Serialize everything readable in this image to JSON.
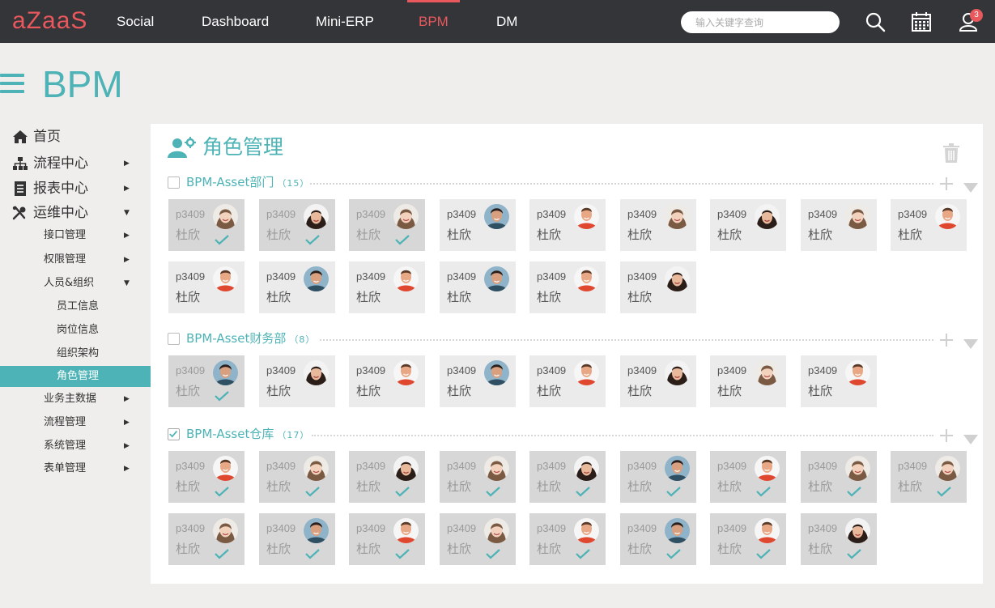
{
  "app": {
    "logo": "aZaaS",
    "nav": [
      "Social",
      "Dashboard",
      "Mini-ERP",
      "BPM",
      "DM"
    ],
    "active_nav": "BPM",
    "search_placeholder": "输入关键字查询",
    "notification_count": "3",
    "accent_color": "#4db3b6",
    "brand_color": "#e8585c"
  },
  "page": {
    "title": "BPM"
  },
  "sidebar": [
    {
      "label": "首页",
      "level": 0,
      "icon": "home-icon",
      "arrow": ""
    },
    {
      "label": "流程中心",
      "level": 0,
      "icon": "sitemap-icon",
      "arrow": "▶"
    },
    {
      "label": "报表中心",
      "level": 0,
      "icon": "report-icon",
      "arrow": "▶"
    },
    {
      "label": "运维中心",
      "level": 0,
      "icon": "tools-icon",
      "arrow": "▼"
    },
    {
      "label": "接口管理",
      "level": 1,
      "arrow": "▶"
    },
    {
      "label": "权限管理",
      "level": 1,
      "arrow": "▶"
    },
    {
      "label": "人员&组织",
      "level": 1,
      "arrow": "▼"
    },
    {
      "label": "员工信息",
      "level": 2,
      "arrow": ""
    },
    {
      "label": "岗位信息",
      "level": 2,
      "arrow": ""
    },
    {
      "label": "组织架构",
      "level": 2,
      "arrow": ""
    },
    {
      "label": "角色管理",
      "level": 2,
      "arrow": "",
      "active": true
    },
    {
      "label": "业务主数据",
      "level": 1,
      "arrow": "▶"
    },
    {
      "label": "流程管理",
      "level": 1,
      "arrow": "▶"
    },
    {
      "label": "系统管理",
      "level": 1,
      "arrow": "▶"
    },
    {
      "label": "表单管理",
      "level": 1,
      "arrow": "▶"
    }
  ],
  "panel": {
    "title": "角色管理",
    "groups": [
      {
        "name": "BPM-Asset部门",
        "count": "（15）",
        "checked": false,
        "members": [
          {
            "id": "p3409",
            "name": "杜欣",
            "selected": true,
            "avatar": "woman-smile"
          },
          {
            "id": "p3409",
            "name": "杜欣",
            "selected": true,
            "avatar": "woman-dark"
          },
          {
            "id": "p3409",
            "name": "杜欣",
            "selected": true,
            "avatar": "woman-smile"
          },
          {
            "id": "p3409",
            "name": "杜欣",
            "selected": false,
            "avatar": "man-outdoor"
          },
          {
            "id": "p3409",
            "name": "杜欣",
            "selected": false,
            "avatar": "man-red"
          },
          {
            "id": "p3409",
            "name": "杜欣",
            "selected": false,
            "avatar": "woman-smile"
          },
          {
            "id": "p3409",
            "name": "杜欣",
            "selected": false,
            "avatar": "woman-dark"
          },
          {
            "id": "p3409",
            "name": "杜欣",
            "selected": false,
            "avatar": "woman-smile"
          },
          {
            "id": "p3409",
            "name": "杜欣",
            "selected": false,
            "avatar": "man-red"
          },
          {
            "id": "p3409",
            "name": "杜欣",
            "selected": false,
            "avatar": "man-red"
          },
          {
            "id": "p3409",
            "name": "杜欣",
            "selected": false,
            "avatar": "man-outdoor"
          },
          {
            "id": "p3409",
            "name": "杜欣",
            "selected": false,
            "avatar": "man-red"
          },
          {
            "id": "p3409",
            "name": "杜欣",
            "selected": false,
            "avatar": "man-outdoor"
          },
          {
            "id": "p3409",
            "name": "杜欣",
            "selected": false,
            "avatar": "man-red"
          },
          {
            "id": "p3409",
            "name": "杜欣",
            "selected": false,
            "avatar": "woman-dark"
          }
        ]
      },
      {
        "name": "BPM-Asset财务部",
        "count": "（8）",
        "checked": false,
        "members": [
          {
            "id": "p3409",
            "name": "杜欣",
            "selected": true,
            "avatar": "man-outdoor"
          },
          {
            "id": "p3409",
            "name": "杜欣",
            "selected": false,
            "avatar": "woman-dark"
          },
          {
            "id": "p3409",
            "name": "杜欣",
            "selected": false,
            "avatar": "man-red"
          },
          {
            "id": "p3409",
            "name": "杜欣",
            "selected": false,
            "avatar": "man-outdoor"
          },
          {
            "id": "p3409",
            "name": "杜欣",
            "selected": false,
            "avatar": "man-red"
          },
          {
            "id": "p3409",
            "name": "杜欣",
            "selected": false,
            "avatar": "woman-dark"
          },
          {
            "id": "p3409",
            "name": "杜欣",
            "selected": false,
            "avatar": "woman-smile"
          },
          {
            "id": "p3409",
            "name": "杜欣",
            "selected": false,
            "avatar": "man-red"
          }
        ]
      },
      {
        "name": "BPM-Asset仓库",
        "count": "（17）",
        "checked": true,
        "members": [
          {
            "id": "p3409",
            "name": "杜欣",
            "selected": true,
            "avatar": "man-red"
          },
          {
            "id": "p3409",
            "name": "杜欣",
            "selected": true,
            "avatar": "woman-smile"
          },
          {
            "id": "p3409",
            "name": "杜欣",
            "selected": true,
            "avatar": "woman-dark"
          },
          {
            "id": "p3409",
            "name": "杜欣",
            "selected": true,
            "avatar": "woman-smile"
          },
          {
            "id": "p3409",
            "name": "杜欣",
            "selected": true,
            "avatar": "woman-dark"
          },
          {
            "id": "p3409",
            "name": "杜欣",
            "selected": true,
            "avatar": "man-outdoor"
          },
          {
            "id": "p3409",
            "name": "杜欣",
            "selected": true,
            "avatar": "man-red"
          },
          {
            "id": "p3409",
            "name": "杜欣",
            "selected": true,
            "avatar": "woman-smile"
          },
          {
            "id": "p3409",
            "name": "杜欣",
            "selected": true,
            "avatar": "woman-smile"
          },
          {
            "id": "p3409",
            "name": "杜欣",
            "selected": true,
            "avatar": "woman-smile"
          },
          {
            "id": "p3409",
            "name": "杜欣",
            "selected": true,
            "avatar": "man-outdoor"
          },
          {
            "id": "p3409",
            "name": "杜欣",
            "selected": true,
            "avatar": "man-red"
          },
          {
            "id": "p3409",
            "name": "杜欣",
            "selected": true,
            "avatar": "woman-smile"
          },
          {
            "id": "p3409",
            "name": "杜欣",
            "selected": true,
            "avatar": "man-red"
          },
          {
            "id": "p3409",
            "name": "杜欣",
            "selected": true,
            "avatar": "man-outdoor"
          },
          {
            "id": "p3409",
            "name": "杜欣",
            "selected": true,
            "avatar": "man-red"
          },
          {
            "id": "p3409",
            "name": "杜欣",
            "selected": true,
            "avatar": "woman-dark"
          }
        ]
      }
    ]
  }
}
